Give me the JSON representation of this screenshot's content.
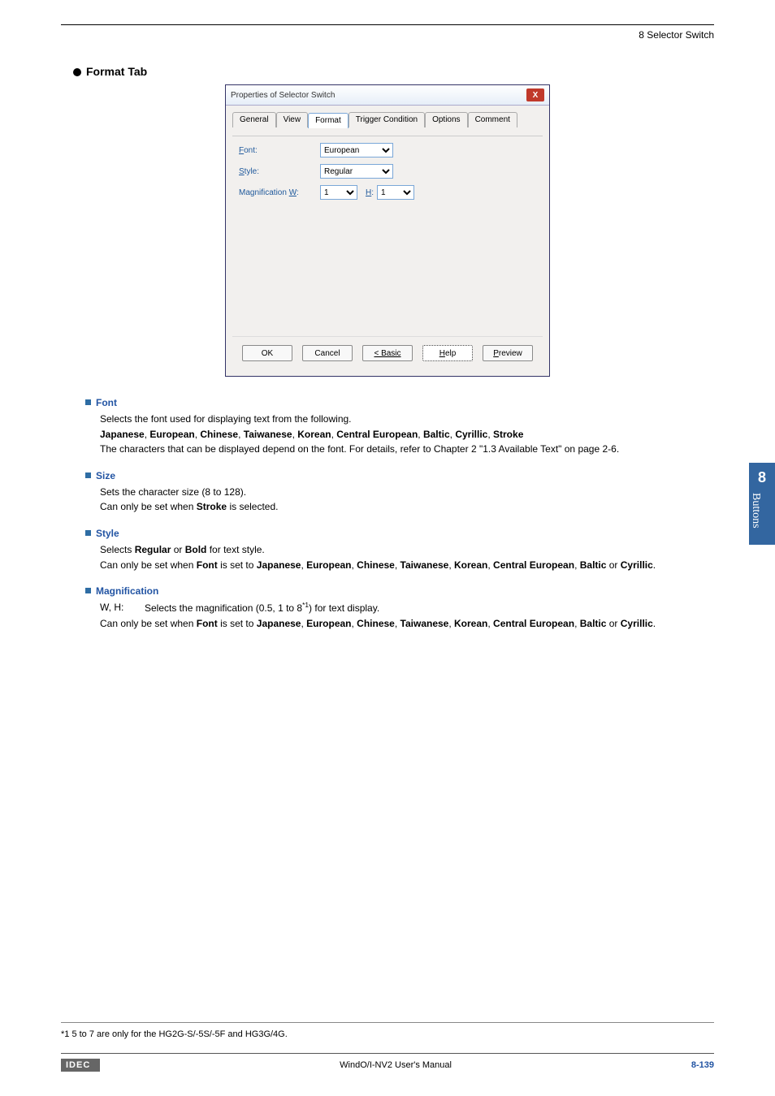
{
  "header": {
    "right": "8 Selector Switch"
  },
  "section": {
    "title_prefix": "Format",
    "title_suffix": " Tab"
  },
  "dialog": {
    "title": "Properties of Selector Switch",
    "tabs": [
      "General",
      "View",
      "Format",
      "Trigger Condition",
      "Options",
      "Comment"
    ],
    "font_label": "Font:",
    "font_value": "European",
    "style_label": "Style:",
    "style_value": "Regular",
    "mag_label": "Magnification W:",
    "mag_w": "1",
    "mag_h_label": "H:",
    "mag_h": "1",
    "buttons": {
      "ok": "OK",
      "cancel": "Cancel",
      "basic": "< Basic",
      "help": "Help",
      "preview": "Preview"
    },
    "close_x": "X"
  },
  "defs": {
    "font": {
      "head": "Font",
      "l1": "Selects the font used for displaying text from the following.",
      "l2": "Japanese, European, Chinese, Taiwanese, Korean, Central European, Baltic, Cyrillic, Stroke",
      "l3": "The characters that can be displayed depend on the font. For details, refer to Chapter 2 \"1.3 Available Text\" on page 2-6."
    },
    "size": {
      "head": "Size",
      "l1": "Sets the character size (8 to 128).",
      "l2_a": "Can only be set when ",
      "l2_b": "Stroke",
      "l2_c": " is selected."
    },
    "style": {
      "head": "Style",
      "l1_a": "Selects ",
      "l1_b": "Regular",
      "l1_c": " or ",
      "l1_d": "Bold",
      "l1_e": " for text style.",
      "l2_a": "Can only be set when ",
      "l2_b": "Font",
      "l2_c": " is set to ",
      "l2_d": "Japanese",
      "l2_e": ", ",
      "l2_f": "European",
      "l2_g": ", ",
      "l2_h": "Chinese",
      "l2_i": ", ",
      "l2_j": "Taiwanese",
      "l2_k": ", ",
      "l2_l": "Korean",
      "l2_m": ", ",
      "l2_n": "Central European",
      "l2_o": ", ",
      "l2_p": "Baltic",
      "l2_q": " or ",
      "l2_r": "Cyrillic",
      "l2_s": "."
    },
    "mag": {
      "head": "Magnification",
      "wh": "W, H:",
      "l1_a": "Selects the magnification (0.5, 1 to 8",
      "l1_sup": "*1",
      "l1_b": ") for text display.",
      "l2_a": "Can only be set when ",
      "l2_b": "Font",
      "l2_c": " is set to ",
      "l2_d": "Japanese",
      "l2_e": ", ",
      "l2_f": "European",
      "l2_g": ", ",
      "l2_h": "Chinese",
      "l2_i": ", ",
      "l2_j": "Taiwanese",
      "l2_k": ", ",
      "l2_l": "Korean",
      "l2_m": ", ",
      "l2_n": "Central European",
      "l2_o": ", ",
      "l2_p": "Baltic",
      "l2_q": " or ",
      "l2_r": "Cyrillic",
      "l2_s": "."
    }
  },
  "footnote": "*1  5 to 7 are only for the HG2G-S/-5S/-5F and HG3G/4G.",
  "sidebar": {
    "num": "8",
    "label": "Buttons"
  },
  "footer": {
    "logo": "IDEC",
    "center": "WindO/I-NV2 User's Manual",
    "page": "8-139"
  }
}
